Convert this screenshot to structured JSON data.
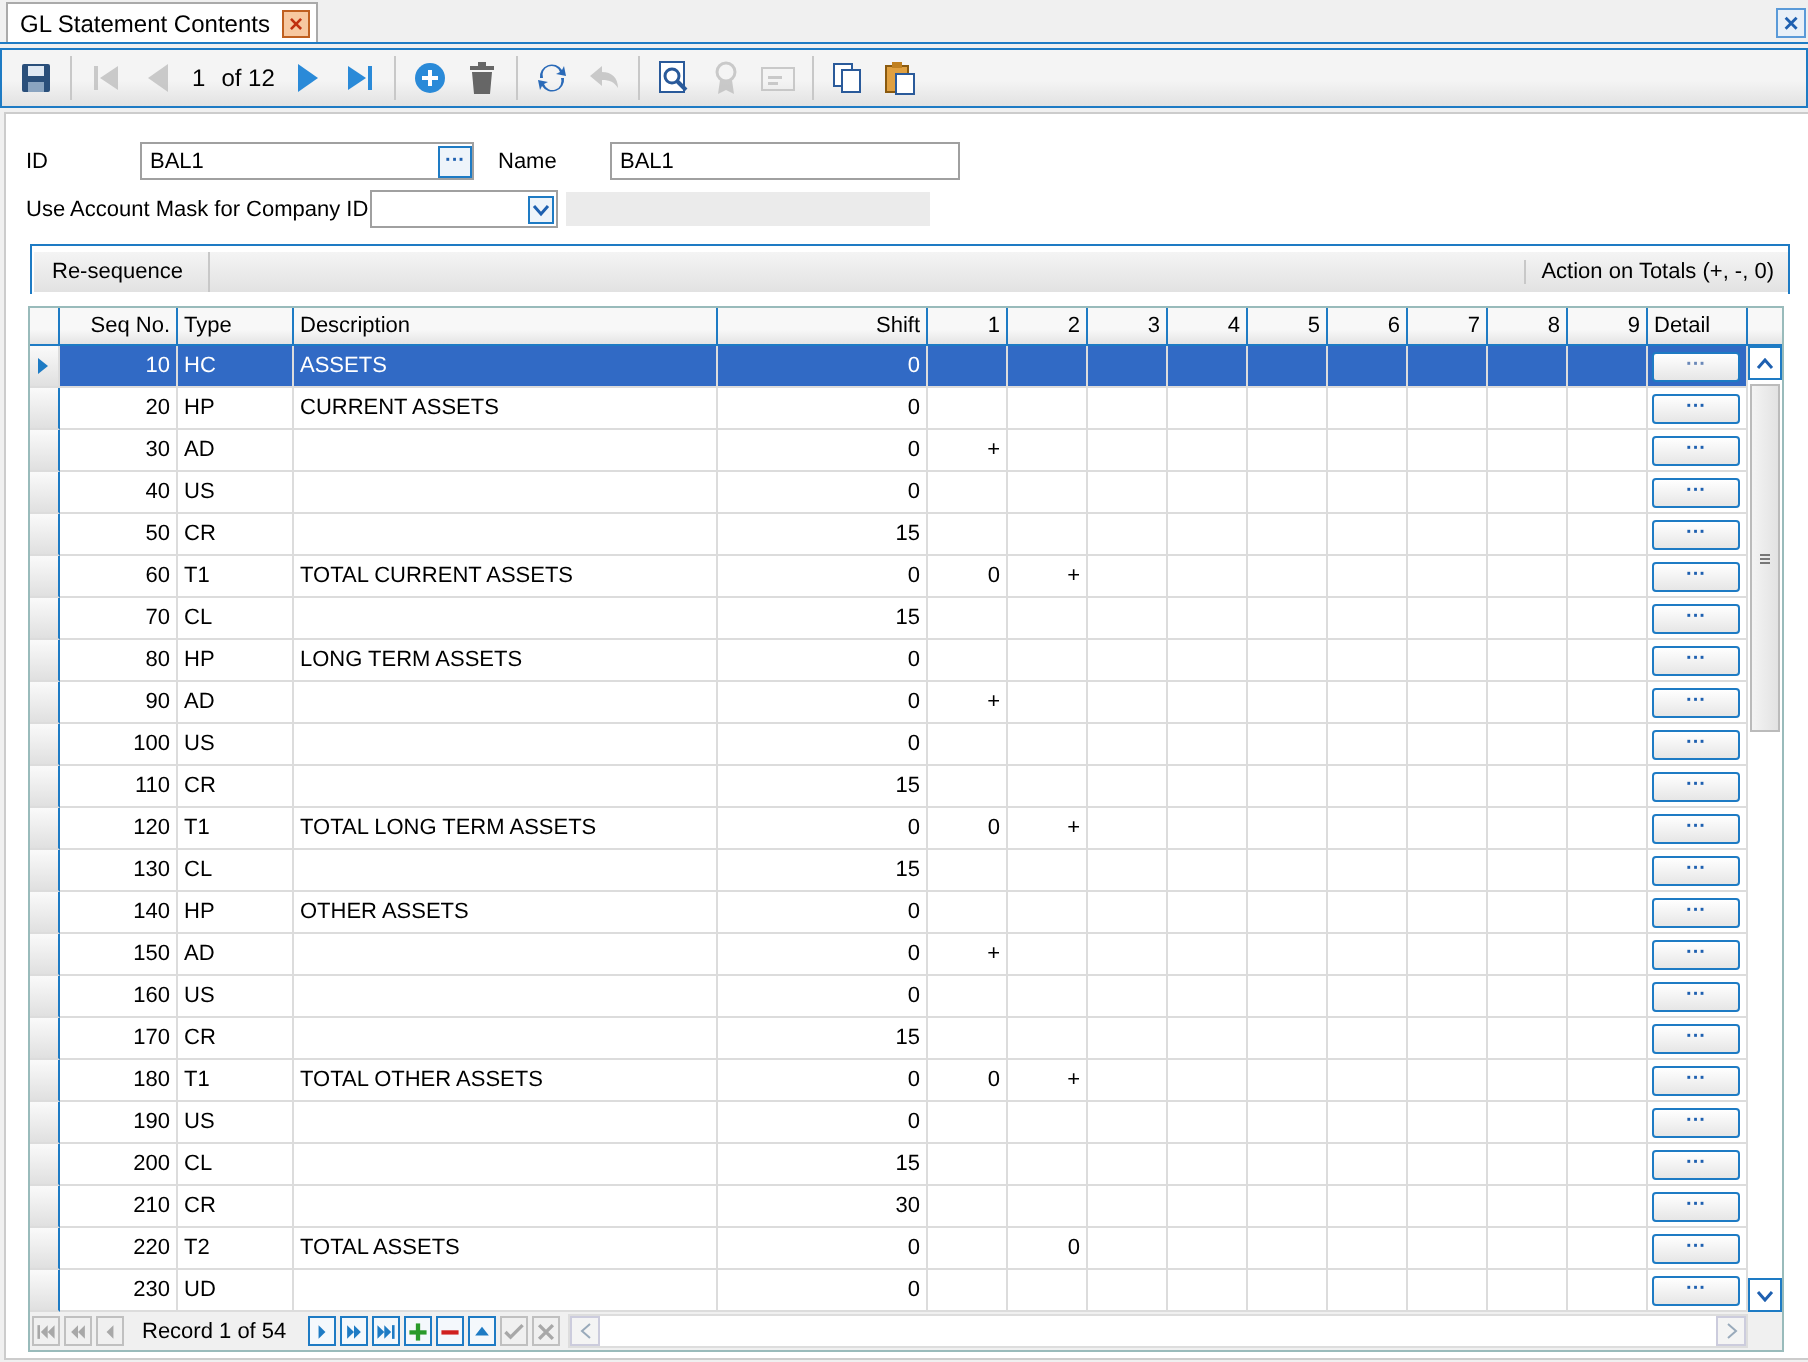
{
  "tab": {
    "title": "GL Statement Contents",
    "close": "×"
  },
  "window_close": "×",
  "toolbar": {
    "buttons": [
      {
        "disabled": false
      },
      {
        "disabled": true
      },
      {
        "disabled": true
      },
      {
        "disabled": false
      },
      {
        "disabled": false
      },
      {
        "disabled": false
      },
      {
        "disabled": false
      },
      {
        "disabled": false
      },
      {
        "disabled": true
      },
      {
        "disabled": false
      },
      {
        "disabled": true
      },
      {
        "disabled": true
      },
      {
        "disabled": false
      },
      {
        "disabled": false
      }
    ],
    "record": "1",
    "of": "of 12"
  },
  "form": {
    "id_label": "ID",
    "id_value": "BAL1",
    "lookup": "···",
    "name_label": "Name",
    "name_value": "BAL1",
    "mask_label": "Use Account Mask for Company ID"
  },
  "group": {
    "button": "Re-sequence",
    "caption": "Action on Totals (+, -, 0)"
  },
  "table": {
    "columns": [
      "Seq No.",
      "Type",
      "Description",
      "Shift",
      "1",
      "2",
      "3",
      "4",
      "5",
      "6",
      "7",
      "8",
      "9",
      "Detail"
    ],
    "rows": [
      {
        "seq": "10",
        "type": "HC",
        "description": "ASSETS",
        "shift": "0",
        "totals": {},
        "detail": "···",
        "selected": true
      },
      {
        "seq": "20",
        "type": "HP",
        "description": "CURRENT ASSETS",
        "shift": "0",
        "totals": {},
        "detail": "···",
        "selected": false
      },
      {
        "seq": "30",
        "type": "AD",
        "shift": "0",
        "totals": {
          "c1": "+"
        },
        "detail": "···",
        "selected": false
      },
      {
        "seq": "40",
        "type": "US",
        "shift": "0",
        "totals": {},
        "detail": "···",
        "selected": false
      },
      {
        "seq": "50",
        "type": "CR",
        "shift": "15",
        "totals": {},
        "detail": "···",
        "selected": false
      },
      {
        "seq": "60",
        "type": "T1",
        "description": "TOTAL CURRENT ASSETS",
        "shift": "0",
        "totals": {
          "c1": "0",
          "c2": "+"
        },
        "detail": "···",
        "selected": false
      },
      {
        "seq": "70",
        "type": "CL",
        "shift": "15",
        "totals": {},
        "detail": "···",
        "selected": false
      },
      {
        "seq": "80",
        "type": "HP",
        "description": "LONG TERM ASSETS",
        "shift": "0",
        "totals": {},
        "detail": "···",
        "selected": false
      },
      {
        "seq": "90",
        "type": "AD",
        "shift": "0",
        "totals": {
          "c1": "+"
        },
        "detail": "···",
        "selected": false
      },
      {
        "seq": "100",
        "type": "US",
        "shift": "0",
        "totals": {},
        "detail": "···",
        "selected": false
      },
      {
        "seq": "110",
        "type": "CR",
        "shift": "15",
        "totals": {},
        "detail": "···",
        "selected": false
      },
      {
        "seq": "120",
        "type": "T1",
        "description": "TOTAL LONG TERM ASSETS",
        "shift": "0",
        "totals": {
          "c1": "0",
          "c2": "+"
        },
        "detail": "···",
        "selected": false
      },
      {
        "seq": "130",
        "type": "CL",
        "shift": "15",
        "totals": {},
        "detail": "···",
        "selected": false
      },
      {
        "seq": "140",
        "type": "HP",
        "description": "OTHER ASSETS",
        "shift": "0",
        "totals": {},
        "detail": "···",
        "selected": false
      },
      {
        "seq": "150",
        "type": "AD",
        "shift": "0",
        "totals": {
          "c1": "+"
        },
        "detail": "···",
        "selected": false
      },
      {
        "seq": "160",
        "type": "US",
        "shift": "0",
        "totals": {},
        "detail": "···",
        "selected": false
      },
      {
        "seq": "170",
        "type": "CR",
        "shift": "15",
        "totals": {},
        "detail": "···",
        "selected": false
      },
      {
        "seq": "180",
        "type": "T1",
        "description": "TOTAL OTHER ASSETS",
        "shift": "0",
        "totals": {
          "c1": "0",
          "c2": "+"
        },
        "detail": "···",
        "selected": false
      },
      {
        "seq": "190",
        "type": "US",
        "shift": "0",
        "totals": {},
        "detail": "···",
        "selected": false
      },
      {
        "seq": "200",
        "type": "CL",
        "shift": "15",
        "totals": {},
        "detail": "···",
        "selected": false
      },
      {
        "seq": "210",
        "type": "CR",
        "shift": "30",
        "totals": {},
        "detail": "···",
        "selected": false
      },
      {
        "seq": "220",
        "type": "T2",
        "description": "TOTAL ASSETS",
        "shift": "0",
        "totals": {
          "c2": "0"
        },
        "detail": "···",
        "selected": false
      },
      {
        "seq": "230",
        "type": "UD",
        "shift": "0",
        "totals": {},
        "detail": "···",
        "selected": false
      }
    ]
  },
  "navigator": {
    "record": "Record 1 of 54",
    "buttons": [
      {
        "disabled": true
      },
      {
        "disabled": true
      },
      {
        "disabled": true
      },
      {
        "disabled": false
      },
      {
        "disabled": false
      },
      {
        "disabled": false
      },
      {
        "disabled": false
      },
      {
        "disabled": false
      },
      {
        "disabled": false
      },
      {
        "disabled": true
      },
      {
        "disabled": true
      }
    ]
  }
}
